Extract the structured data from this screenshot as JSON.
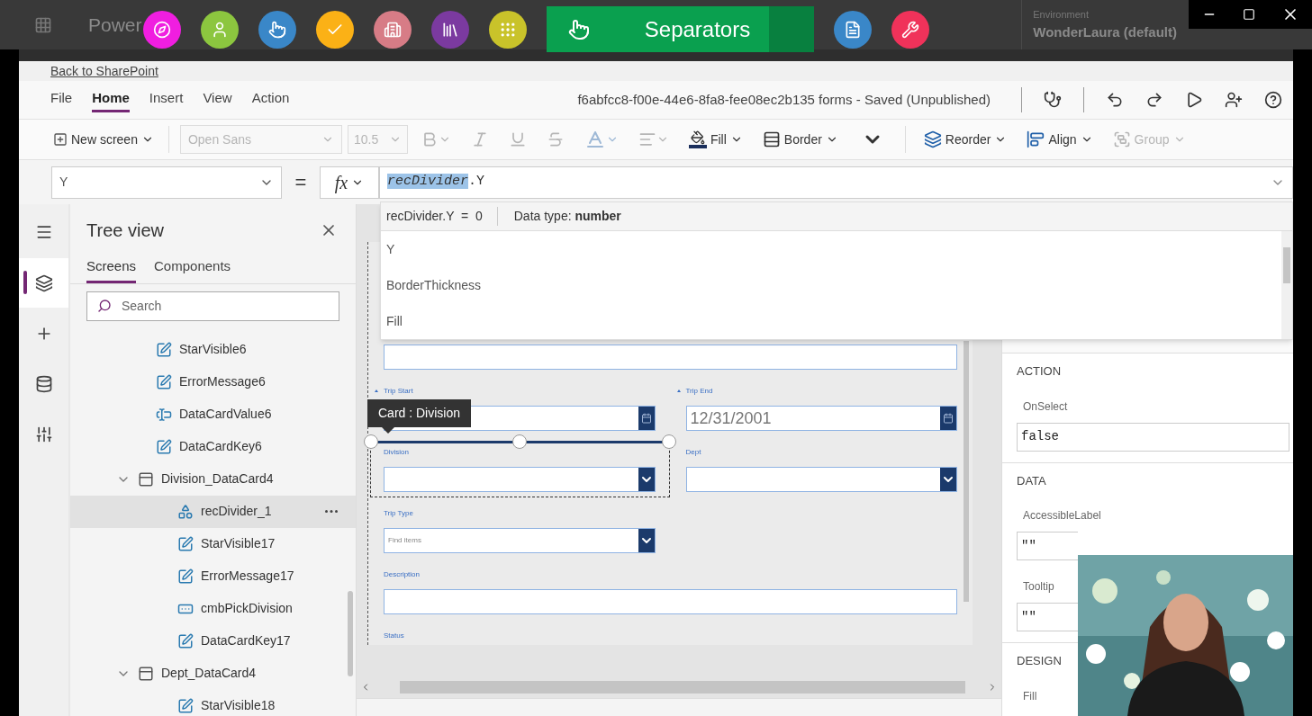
{
  "app_header": {
    "brand": "Power",
    "environment_label": "Environment",
    "environment": "WonderLaura (default)"
  },
  "overlay_toolbar": [
    {
      "kind": "compass",
      "color": "#f01ee0",
      "selected": false
    },
    {
      "kind": "person",
      "color": "#8cc63f",
      "selected": false
    },
    {
      "kind": "hand",
      "color": "#3a87c8",
      "selected": false
    },
    {
      "kind": "check",
      "color": "#fbb116",
      "selected": false
    },
    {
      "kind": "building",
      "color": "#d77c86",
      "selected": false
    },
    {
      "kind": "library",
      "color": "#7b3aa0",
      "selected": false
    },
    {
      "kind": "dots",
      "color": "#c9c32a",
      "selected": false
    },
    {
      "kind": "hand",
      "color": "#0aa04f",
      "selected": true,
      "label": "Separators"
    },
    {
      "kind": "document",
      "color": "#3a87c8",
      "selected": false
    },
    {
      "kind": "tools",
      "color": "#f0325a",
      "selected": false
    }
  ],
  "back_link": "Back to SharePoint",
  "menu": [
    {
      "label": "File",
      "selected": false
    },
    {
      "label": "Home",
      "selected": true
    },
    {
      "label": "Insert",
      "selected": false
    },
    {
      "label": "View",
      "selected": false
    },
    {
      "label": "Action",
      "selected": false
    }
  ],
  "document_title": "f6abfcc8-f00e-44e6-8fa8-fee08ec2b135 forms - Saved (Unpublished)",
  "header_actions": [
    {
      "kind": "checker"
    },
    {
      "kind": "undo"
    },
    {
      "kind": "redo"
    },
    {
      "kind": "play"
    },
    {
      "kind": "share"
    },
    {
      "kind": "help"
    }
  ],
  "toolbar": [
    {
      "kind": "new_screen",
      "label": "New screen",
      "disabled": false
    },
    {
      "kind": "font",
      "value": "Open Sans",
      "disabled": true
    },
    {
      "kind": "size",
      "value": "10.5",
      "disabled": true
    },
    {
      "kind": "bold",
      "disabled": true
    },
    {
      "kind": "italic",
      "disabled": true
    },
    {
      "kind": "underline",
      "disabled": true
    },
    {
      "kind": "strike",
      "disabled": true
    },
    {
      "kind": "font_color",
      "disabled": true
    },
    {
      "kind": "text_align",
      "disabled": true
    },
    {
      "kind": "fill",
      "label": "Fill",
      "disabled": false
    },
    {
      "kind": "border",
      "label": "Border",
      "disabled": false
    },
    {
      "kind": "more",
      "disabled": false
    },
    {
      "kind": "reorder",
      "label": "Reorder",
      "disabled": false
    },
    {
      "kind": "align",
      "label": "Align",
      "disabled": false
    },
    {
      "kind": "group",
      "label": "Group",
      "disabled": true
    }
  ],
  "formula_bar": {
    "property": "Y",
    "equals": "=",
    "fx": "fx",
    "formula": [
      {
        "text": "recDivider",
        "selected": true
      },
      {
        "text": ".Y",
        "selected": false
      }
    ],
    "result": "recDivider.Y  =  0",
    "data_type": "Data type: **number**",
    "suggestions": [
      "Y",
      "BorderThickness",
      "Fill"
    ]
  },
  "left_rail": [
    {
      "kind": "menu",
      "selected": false
    },
    {
      "kind": "layers",
      "selected": true
    },
    {
      "kind": "insert",
      "selected": false
    },
    {
      "kind": "data",
      "selected": false
    },
    {
      "kind": "tools",
      "selected": false
    }
  ],
  "tree_view": {
    "title": "Tree view",
    "tabs": [
      {
        "label": "Screens",
        "selected": true
      },
      {
        "label": "Components",
        "selected": false
      }
    ],
    "search_placeholder": "Search",
    "items": [
      {
        "label": "StarVisible6",
        "kind": "label",
        "selected": false
      },
      {
        "label": "ErrorMessage6",
        "kind": "label",
        "selected": false
      },
      {
        "label": "DataCardValue6",
        "kind": "input",
        "selected": false
      },
      {
        "label": "DataCardKey6",
        "kind": "label",
        "selected": false
      },
      {
        "label": "Division_DataCard4",
        "kind": "card",
        "selected": false,
        "expanded": true,
        "children": [
          {
            "label": "recDivider_1",
            "kind": "shape",
            "selected": true
          },
          {
            "label": "StarVisible17",
            "kind": "label",
            "selected": false
          },
          {
            "label": "ErrorMessage17",
            "kind": "label",
            "selected": false
          },
          {
            "label": "cmbPickDivision",
            "kind": "combo",
            "selected": false
          },
          {
            "label": "DataCardKey17",
            "kind": "label",
            "selected": false
          }
        ]
      },
      {
        "label": "Dept_DataCard4",
        "kind": "card",
        "selected": false,
        "expanded": true,
        "children": [
          {
            "label": "StarVisible18",
            "kind": "label",
            "selected": false
          }
        ]
      }
    ]
  },
  "form": {
    "tooltip": "Card : Division",
    "rows": [
      [
        {
          "kind": "text",
          "wide": true,
          "required": false,
          "selected": false
        }
      ],
      [
        {
          "label": "Trip Start",
          "kind": "date",
          "required": true,
          "selected": false
        },
        {
          "label": "Trip End",
          "kind": "date",
          "value": "12/31/2001",
          "required": true,
          "selected": false
        }
      ],
      [
        {
          "label": "Division",
          "kind": "dropdown",
          "required": false,
          "selected": true
        },
        {
          "label": "Dept",
          "kind": "dropdown",
          "required": false,
          "selected": false
        }
      ],
      [
        {
          "label": "Trip Type",
          "kind": "combo",
          "placeholder": "Find items",
          "required": false,
          "selected": false
        }
      ],
      [
        {
          "label": "Description",
          "kind": "text",
          "wide": true,
          "required": false,
          "selected": false
        }
      ],
      [
        {
          "label": "Status",
          "kind": "label_only",
          "required": false,
          "selected": false
        }
      ]
    ]
  },
  "properties": [
    {
      "title": "ACTION",
      "props": [
        {
          "name": "OnSelect",
          "value": "false"
        }
      ]
    },
    {
      "title": "DATA",
      "props": [
        {
          "name": "AccessibleLabel",
          "value": "\"\""
        },
        {
          "name": "Tooltip",
          "value": "\"\""
        }
      ]
    },
    {
      "title": "DESIGN",
      "props": [
        {
          "name": "Fill"
        }
      ]
    }
  ]
}
